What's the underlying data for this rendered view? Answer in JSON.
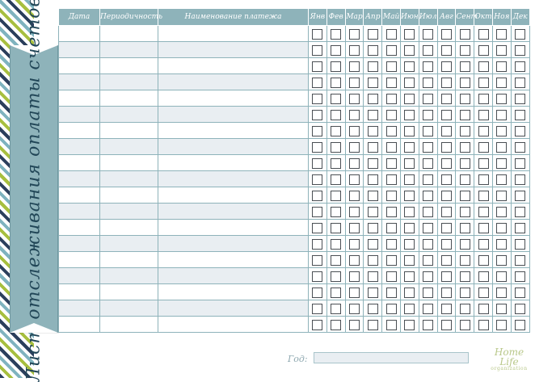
{
  "title": "Лист отслеживания оплаты счетов",
  "table": {
    "headers": [
      "Дата",
      "Периодичность",
      "Наименование платежа"
    ],
    "months": [
      "Янв",
      "Фев",
      "Мар",
      "Апр",
      "Май",
      "Июн",
      "Июл",
      "Авг",
      "Сент",
      "Окт",
      "Ноя",
      "Дек"
    ],
    "row_count": 19
  },
  "footer": {
    "year_label": "Год:",
    "year_value": ""
  },
  "logo": {
    "line1": "Home Life",
    "line2": "organization"
  },
  "colors": {
    "header": "#8eb3ba",
    "row_alt": "#e9eef2",
    "ribbon": "#8eb3ba"
  }
}
